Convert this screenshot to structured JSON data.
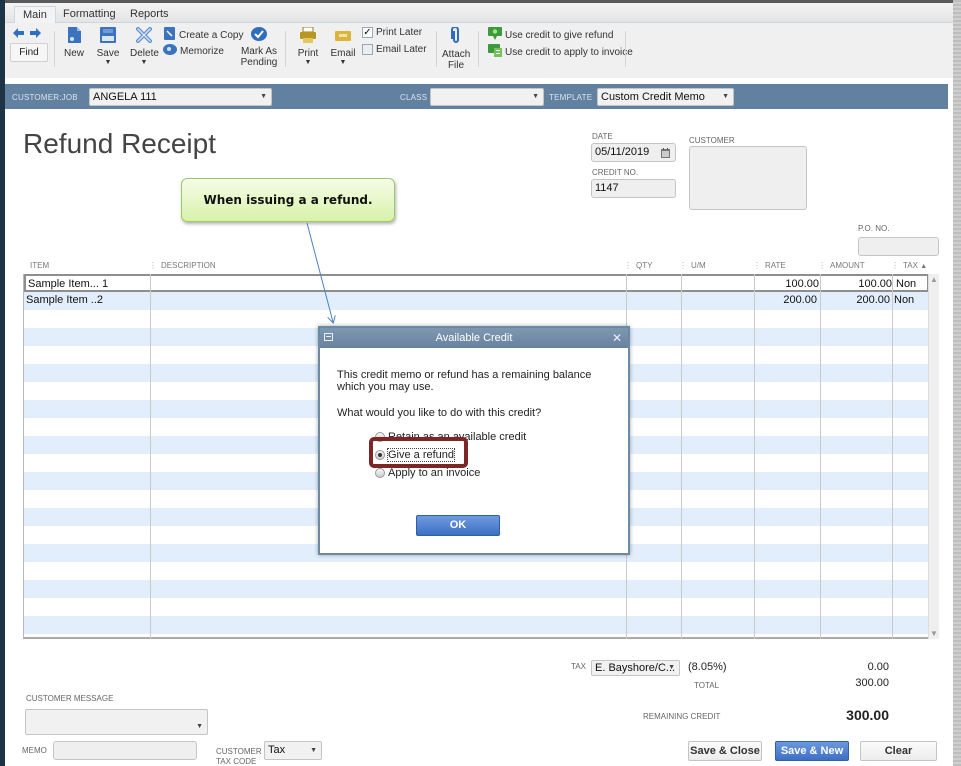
{
  "ribbon": {
    "tabs": [
      {
        "label": "Main",
        "active": true
      },
      {
        "label": "Formatting",
        "active": false
      },
      {
        "label": "Reports",
        "active": false
      }
    ],
    "buttons": {
      "find": "Find",
      "new": "New",
      "save": "Save",
      "delete": "Delete",
      "create_copy": "Create a Copy",
      "memorize": "Memorize",
      "mark_as_pending_line1": "Mark As",
      "mark_as_pending_line2": "Pending",
      "print": "Print",
      "email": "Email",
      "print_later": "Print Later",
      "email_later": "Email Later",
      "attach_file_line1": "Attach",
      "attach_file_line2": "File",
      "use_credit_refund": "Use credit to give refund",
      "use_credit_invoice": "Use credit to apply to invoice"
    },
    "print_later_checked": true,
    "email_later_checked": false
  },
  "header": {
    "customer_job_label": "CUSTOMER:JOB",
    "customer_job_value": "ANGELA 111",
    "class_label": "CLASS",
    "class_value": "",
    "template_label": "TEMPLATE",
    "template_value": "Custom Credit Memo"
  },
  "form": {
    "title": "Refund Receipt",
    "date_label": "DATE",
    "date_value": "05/11/2019",
    "credit_no_label": "CREDIT NO.",
    "credit_no_value": "1147",
    "customer_label": "CUSTOMER",
    "customer_value": "",
    "po_no_label": "P.O. NO.",
    "po_no_value": ""
  },
  "callout": {
    "text": "When issuing a a refund."
  },
  "table": {
    "columns": [
      "ITEM",
      "DESCRIPTION",
      "QTY",
      "U/M",
      "RATE",
      "AMOUNT",
      "TAX"
    ],
    "rows": [
      {
        "item": "Sample Item... 1",
        "description": "",
        "qty": "",
        "um": "",
        "rate": "100.00",
        "amount": "100.00",
        "tax": "Non"
      },
      {
        "item": "Sample Item ..2",
        "description": "",
        "qty": "",
        "um": "",
        "rate": "200.00",
        "amount": "200.00",
        "tax": "Non"
      }
    ]
  },
  "dialog": {
    "title": "Available Credit",
    "message": "This credit memo or refund has a remaining balance which you may use.",
    "question": "What would you like to do with this credit?",
    "options": [
      {
        "label": "Retain as an available credit",
        "selected": false
      },
      {
        "label": "Give a refund",
        "selected": true
      },
      {
        "label": "Apply to an invoice",
        "selected": false
      }
    ],
    "ok_label": "OK"
  },
  "footer": {
    "tax_label": "TAX",
    "tax_item": "E. Bayshore/C...",
    "tax_rate": "(8.05%)",
    "tax_amount": "0.00",
    "total_label": "TOTAL",
    "total_value": "300.00",
    "remaining_credit_label": "REMAINING CREDIT",
    "remaining_credit_value": "300.00",
    "customer_message_label": "CUSTOMER MESSAGE",
    "customer_message_value": "",
    "memo_label": "MEMO",
    "memo_value": "",
    "customer_tax_code_label_1": "CUSTOMER",
    "customer_tax_code_label_2": "TAX CODE",
    "customer_tax_code_value": "Tax",
    "save_close_label": "Save & Close",
    "save_new_label": "Save & New",
    "clear_label": "Clear"
  }
}
